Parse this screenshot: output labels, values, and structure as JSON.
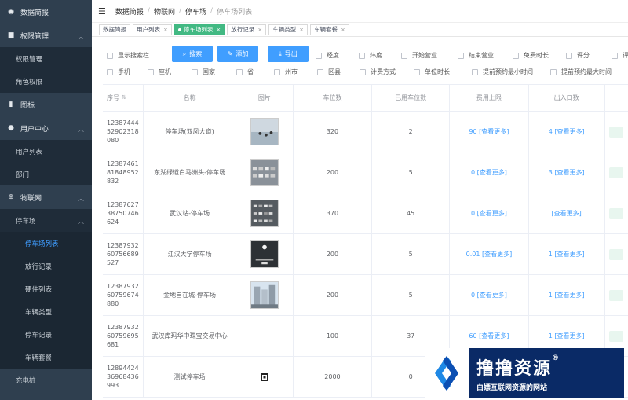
{
  "sidebar": {
    "items": [
      {
        "label": "数据简报"
      },
      {
        "label": "权限管理"
      },
      {
        "label": "权限管理"
      },
      {
        "label": "角色权限"
      },
      {
        "label": "图标"
      },
      {
        "label": "用户中心"
      },
      {
        "label": "用户列表"
      },
      {
        "label": "部门"
      },
      {
        "label": "物联网"
      },
      {
        "label": "停车场"
      },
      {
        "label": "停车场列表"
      },
      {
        "label": "放行记录"
      },
      {
        "label": "硬件列表"
      },
      {
        "label": "车辆类型"
      },
      {
        "label": "停车记录"
      },
      {
        "label": "车辆套餐"
      },
      {
        "label": "充电桩"
      }
    ]
  },
  "header": {
    "breadcrumb": [
      "数据简报",
      "物联网",
      "停车场",
      "停车场列表"
    ]
  },
  "tags": [
    {
      "label": "数据简报"
    },
    {
      "label": "用户列表"
    },
    {
      "label": "停车场列表"
    },
    {
      "label": "放行记录"
    },
    {
      "label": "车辆类型"
    },
    {
      "label": "车辆套餐"
    }
  ],
  "filters": {
    "show_search": "显示搜索栏",
    "search_btn": "搜索",
    "add_btn": "添加",
    "export_btn": "导出",
    "row1": [
      "经度",
      "纬度",
      "开始营业",
      "结束营业",
      "免费时长",
      "评分",
      "评"
    ],
    "row2": [
      "手机",
      "座机",
      "国家",
      "省",
      "州市",
      "区县",
      "计费方式",
      "单位时长",
      "提前预约最小时间",
      "提前预约最大时间"
    ]
  },
  "table": {
    "headers": [
      "序号",
      "名称",
      "图片",
      "车位数",
      "已用车位数",
      "费用上限",
      "出入口数"
    ],
    "view_more": "[查看更多]",
    "rows": [
      {
        "id": "1238744452902318080",
        "name": "停车场(双凤大道)",
        "spots": "320",
        "used": "2",
        "fee": "90",
        "gate": "4"
      },
      {
        "id": "1238746181848952832",
        "name": "东湖绿道白马洲头-停车场",
        "spots": "200",
        "used": "5",
        "fee": "0",
        "gate": "3"
      },
      {
        "id": "1238762738750746624",
        "name": "武汉站-停车场",
        "spots": "370",
        "used": "45",
        "fee": "0",
        "gate": ""
      },
      {
        "id": "1238793260756689527",
        "name": "江汉大学停车场",
        "spots": "200",
        "used": "5",
        "fee": "0.01",
        "gate": "1"
      },
      {
        "id": "1238793260759674880",
        "name": "金地自在城-停车场",
        "spots": "200",
        "used": "5",
        "fee": "0",
        "gate": "1"
      },
      {
        "id": "1238793260759695681",
        "name": "武汉库玛华中珠宝交易中心",
        "spots": "100",
        "used": "37",
        "fee": "60",
        "gate": "1"
      },
      {
        "id": "1289442436968436993",
        "name": "测试停车场",
        "spots": "2000",
        "used": "0",
        "fee": "",
        "gate": ""
      }
    ]
  },
  "watermark": {
    "title": "撸撸资源",
    "reg": "®",
    "subtitle": "白嫖互联网资源的网站"
  },
  "colors": {
    "sidebar_bg": "#2f3f4f",
    "primary": "#409eff",
    "active_tag": "#42b983",
    "watermark_bg": "#0a2a66"
  }
}
